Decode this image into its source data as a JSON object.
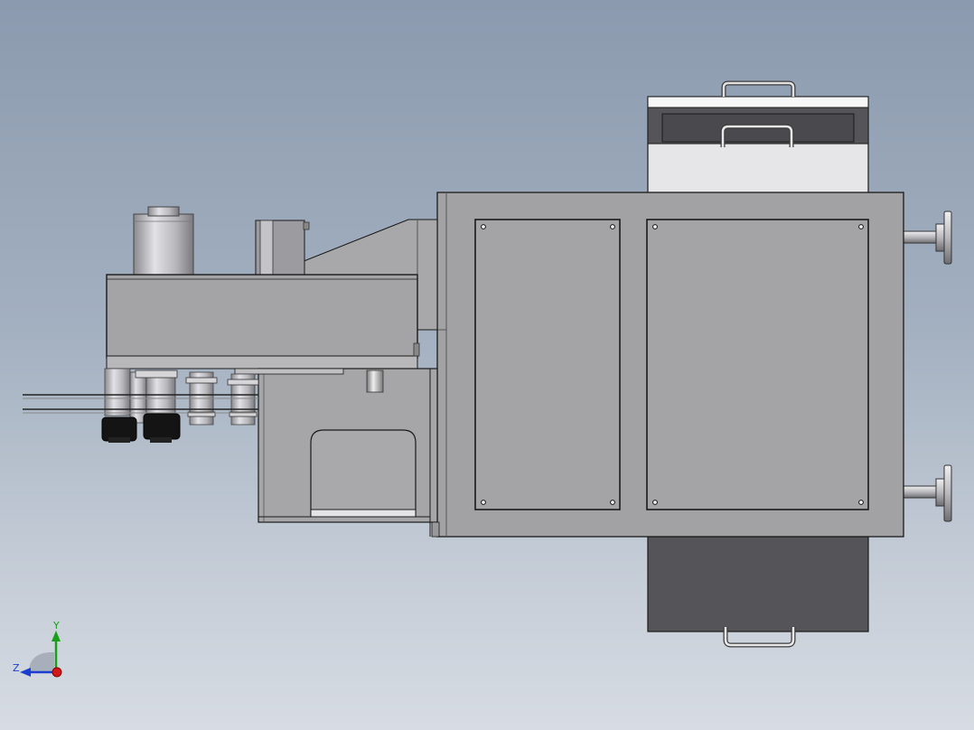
{
  "viewport": {
    "description_label": "",
    "colors": {
      "panel": "#a4a4a4",
      "panel_dark": "#555458",
      "panel_light": "#e8e8e8",
      "steel": "#b9b9bd",
      "outline": "#1a1a1a",
      "axis_x": "#d01818",
      "axis_y": "#18a018",
      "axis_z": "#1a3fd0"
    }
  },
  "triad": {
    "y_label": "Y",
    "z_label": "Z",
    "icons": [
      "axis-triad-icon"
    ]
  }
}
